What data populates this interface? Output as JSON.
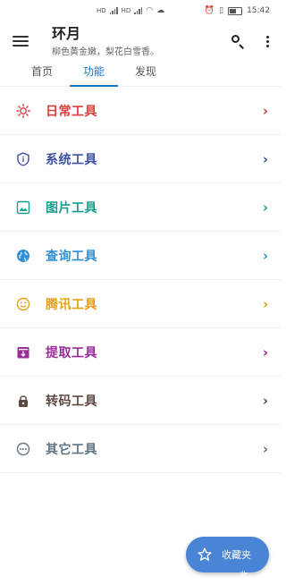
{
  "status_bar": {
    "time": "15:42"
  },
  "app_bar": {
    "title": "环月",
    "subtitle": "柳色黄金嫩，梨花白雪香。"
  },
  "tabs": [
    {
      "label": "首页",
      "active": false
    },
    {
      "label": "功能",
      "active": true
    },
    {
      "label": "发现",
      "active": false
    }
  ],
  "tools": [
    {
      "label": "日常工具",
      "color": "#d8403d",
      "icon": "sun-icon"
    },
    {
      "label": "系统工具",
      "color": "#3f51a5",
      "icon": "shield-info-icon"
    },
    {
      "label": "图片工具",
      "color": "#1a9e8e",
      "icon": "image-icon"
    },
    {
      "label": "查询工具",
      "color": "#2f8fd8",
      "icon": "globe-icon"
    },
    {
      "label": "腾讯工具",
      "color": "#e4a01a",
      "icon": "smiley-icon"
    },
    {
      "label": "提取工具",
      "color": "#9c2b9c",
      "icon": "archive-icon"
    },
    {
      "label": "转码工具",
      "color": "#5d4a42",
      "icon": "lock-icon"
    },
    {
      "label": "其它工具",
      "color": "#5f7482",
      "icon": "more-circle-icon"
    }
  ],
  "fab": {
    "label": "收藏夹",
    "tip": "收"
  }
}
